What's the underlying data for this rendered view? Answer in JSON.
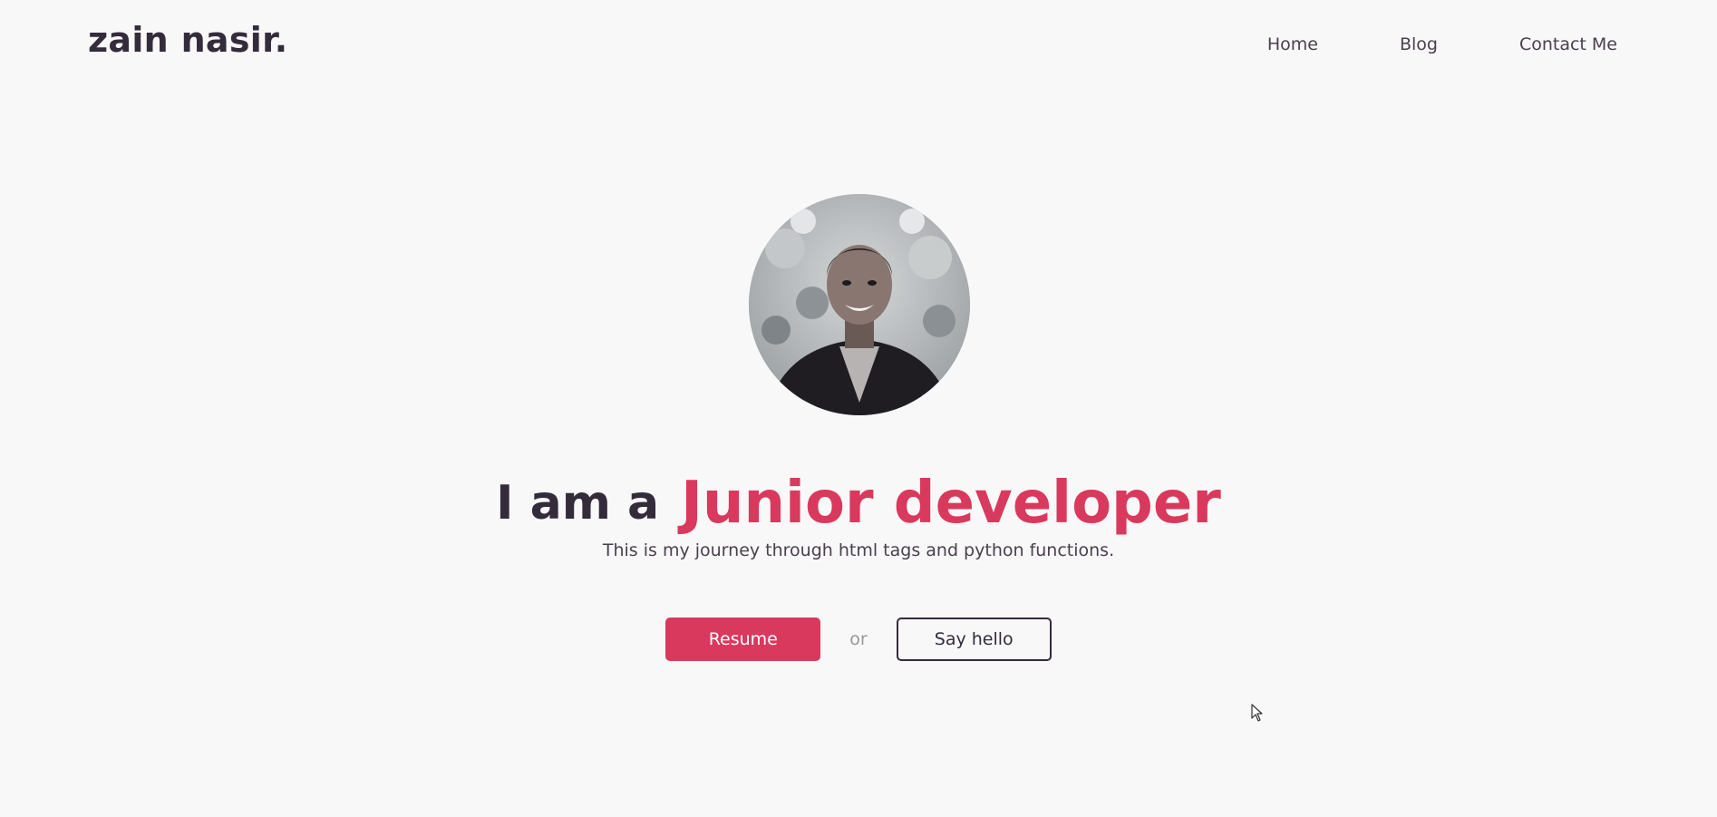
{
  "header": {
    "logo": "zain nasir.",
    "nav": [
      {
        "label": "Home"
      },
      {
        "label": "Blog"
      },
      {
        "label": "Contact Me"
      }
    ]
  },
  "hero": {
    "lead": "I am a",
    "role": "Junior developer",
    "tagline": "This is my journey through html tags and python functions.",
    "primary_button": "Resume",
    "separator": "or",
    "secondary_button": "Say hello"
  },
  "colors": {
    "accent": "#d9395d",
    "text_dark": "#342b3b",
    "background": "#f8f8f8"
  },
  "icons": {
    "avatar": "profile-photo",
    "pointer": "mouse-cursor-icon"
  }
}
